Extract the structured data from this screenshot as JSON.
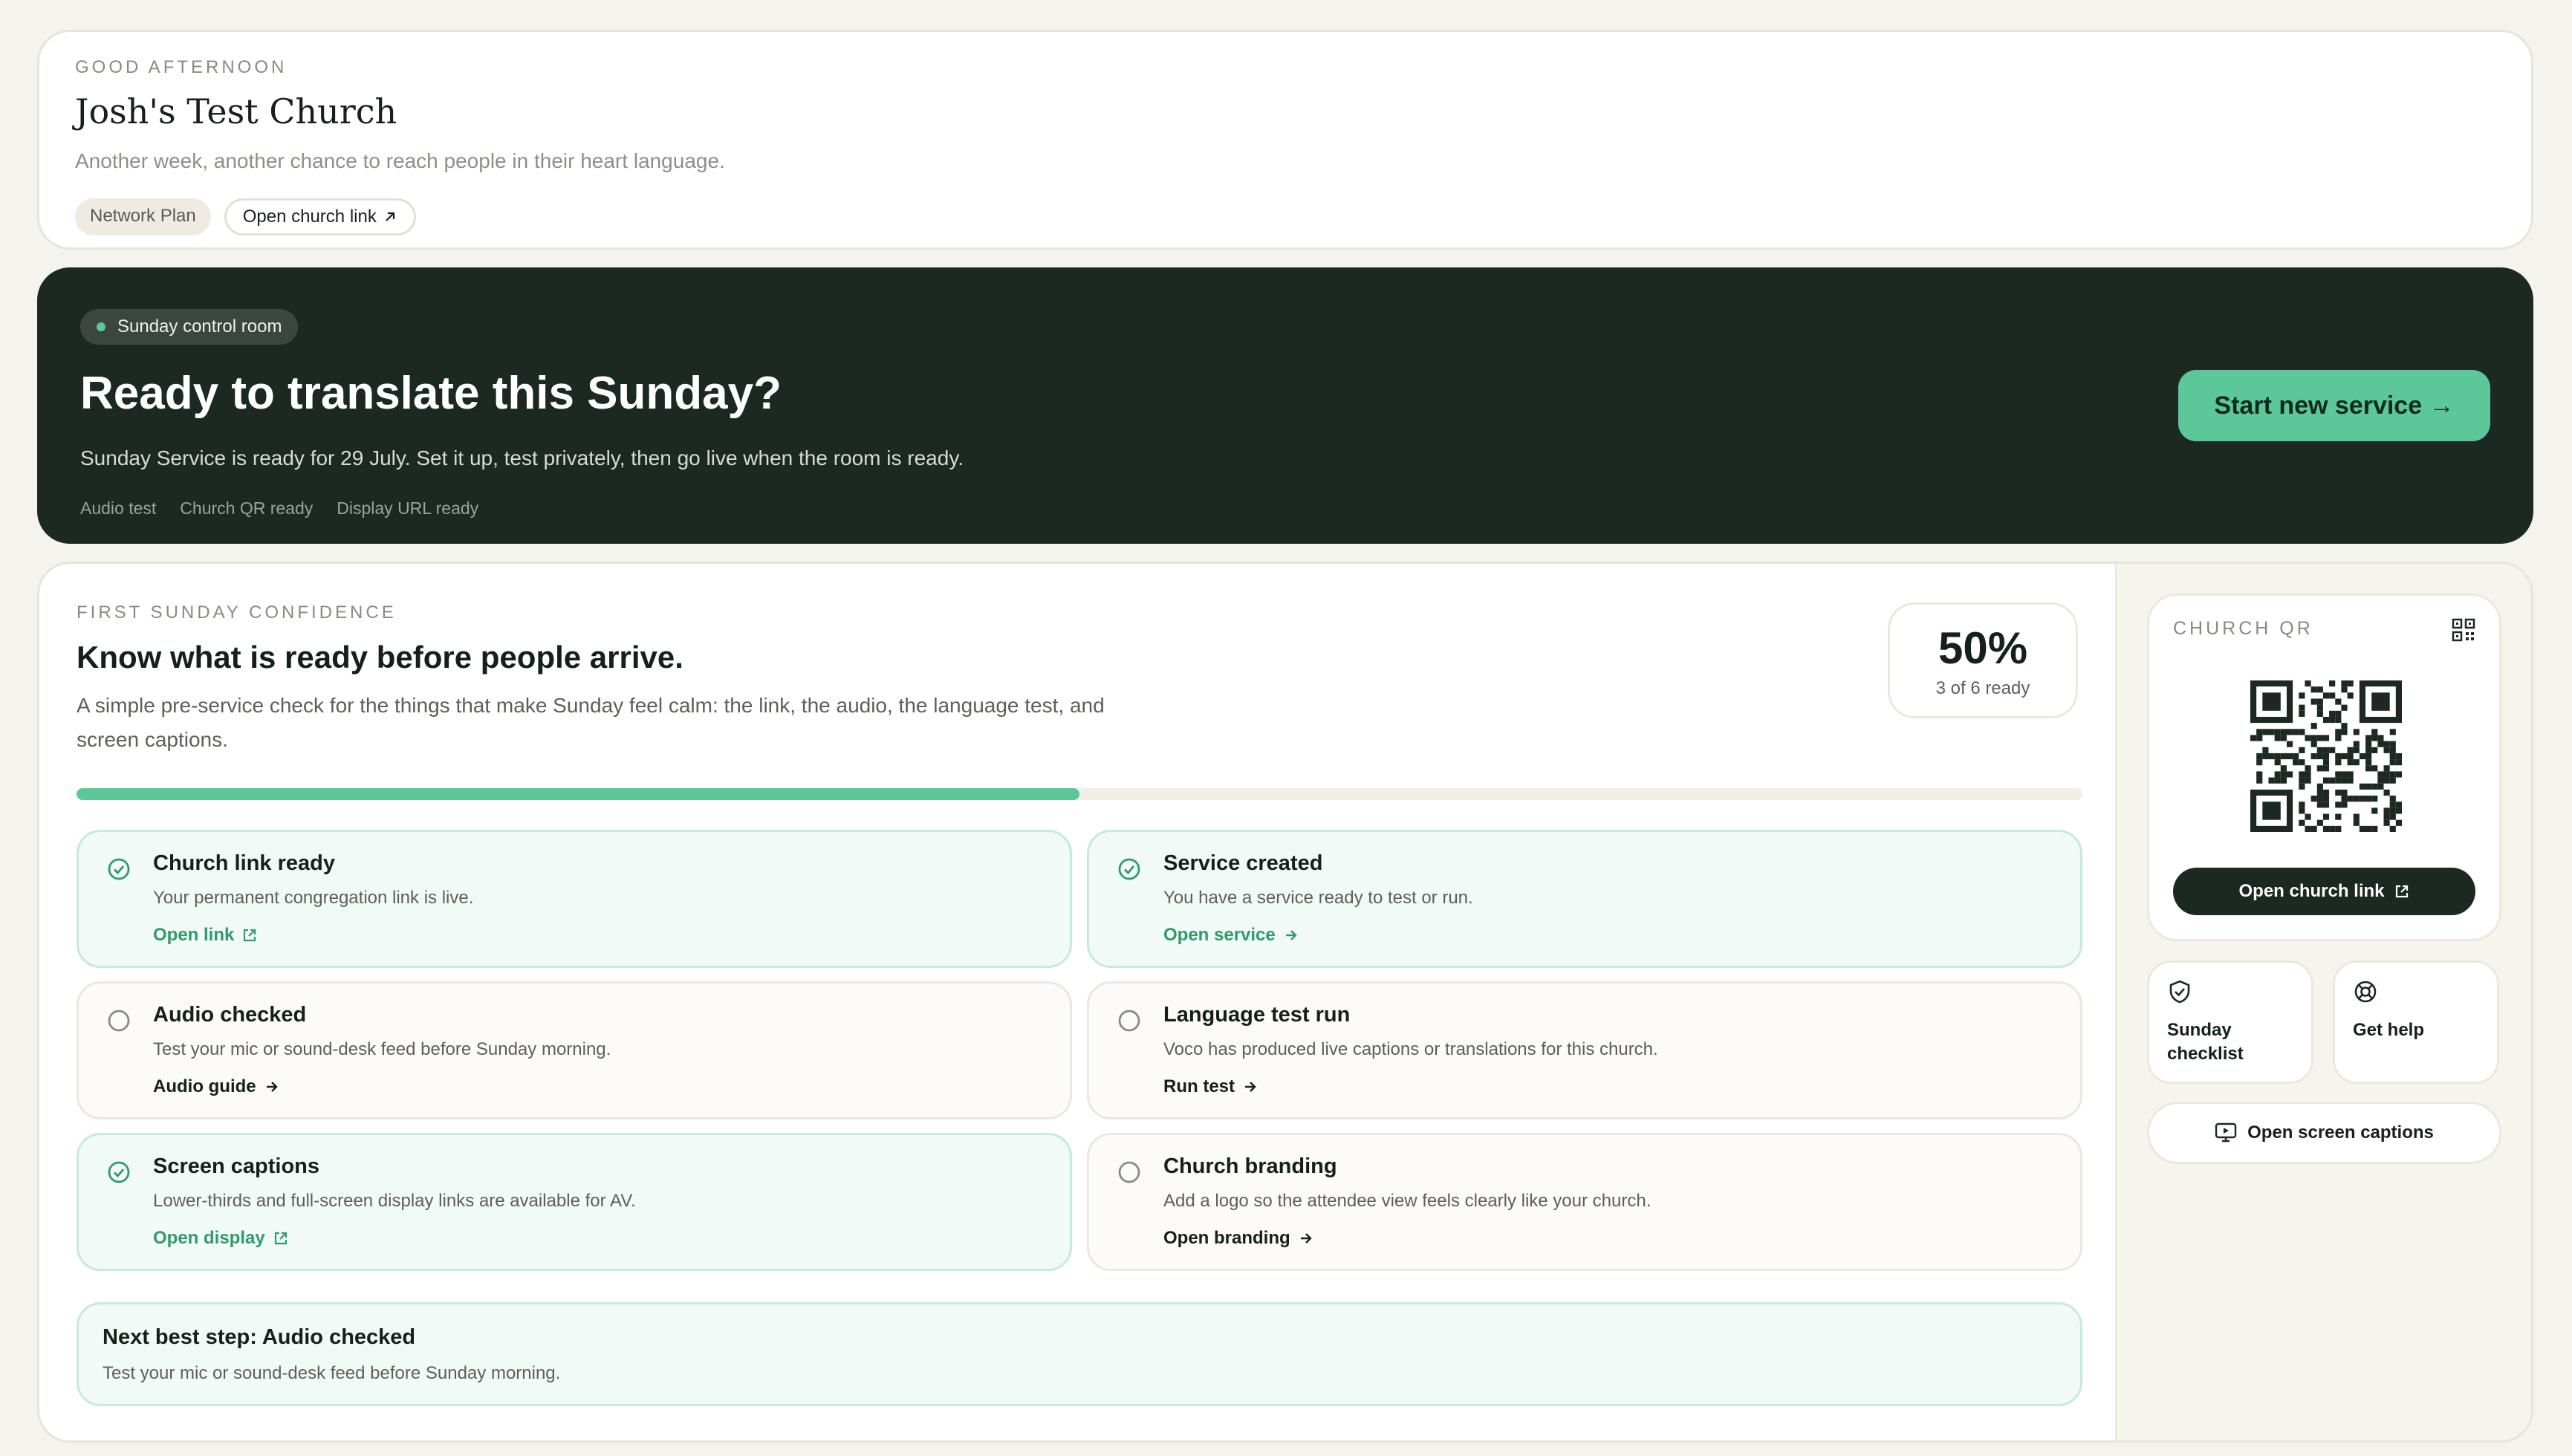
{
  "welcome": {
    "greeting": "GOOD AFTERNOON",
    "church_name": "Josh's Test Church",
    "subtitle": "Another week, another chance to reach people in their heart language.",
    "plan_pill": "Network Plan",
    "church_link": "Open church link"
  },
  "hero": {
    "badge": "Sunday control room",
    "title": "Ready to translate this Sunday?",
    "subtitle": "Sunday Service is ready for 29 July. Set it up, test privately, then go live when the room is ready.",
    "tags": [
      "Audio test",
      "Church QR ready",
      "Display URL ready"
    ],
    "cta": "Start new service →"
  },
  "confidence": {
    "eyebrow": "FIRST SUNDAY CONFIDENCE",
    "title": "Know what is ready before people arrive.",
    "description": "A simple pre-service check for the things that make Sunday feel calm: the link, the audio, the language test, and screen captions.",
    "score": "50%",
    "score_sub": "3 of 6 ready",
    "progress_fraction": 0.5,
    "items": [
      {
        "title": "Church link ready",
        "desc": "Your permanent congregation link is live.",
        "link": "Open link",
        "done": true,
        "link_icon": "external-link-icon"
      },
      {
        "title": "Service created",
        "desc": "You have a service ready to test or run.",
        "link": "Open service",
        "done": true,
        "link_icon": "arrow-right-icon"
      },
      {
        "title": "Audio checked",
        "desc": "Test your mic or sound-desk feed before Sunday morning.",
        "link": "Audio guide",
        "done": false,
        "link_icon": "arrow-right-icon"
      },
      {
        "title": "Language test run",
        "desc": "Voco has produced live captions or translations for this church.",
        "link": "Run test",
        "done": false,
        "link_icon": "arrow-right-icon"
      },
      {
        "title": "Screen captions",
        "desc": "Lower-thirds and full-screen display links are available for AV.",
        "link": "Open display",
        "done": true,
        "link_icon": "external-link-icon"
      },
      {
        "title": "Church branding",
        "desc": "Add a logo so the attendee view feels clearly like your church.",
        "link": "Open branding",
        "done": false,
        "link_icon": "arrow-right-icon"
      }
    ],
    "next_title": "Next best step: Audio checked",
    "next_desc": "Test your mic or sound-desk feed before Sunday morning."
  },
  "sidebar": {
    "qr_label": "CHURCH QR",
    "qr_button": "Open church link",
    "tile_checklist": "Sunday checklist",
    "tile_help": "Get help",
    "captions_button": "Open screen captions"
  },
  "colors": {
    "accent": "#5cc89a",
    "dark": "#1c2822",
    "link_green": "#2f9a6c"
  }
}
